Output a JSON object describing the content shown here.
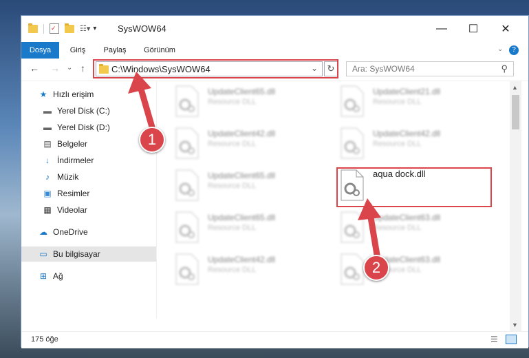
{
  "window": {
    "title": "SysWOW64"
  },
  "window_controls": {
    "minimize": "—",
    "maximize": "☐",
    "close": "✕"
  },
  "ribbon_tabs": [
    "Dosya",
    "Giriş",
    "Paylaş",
    "Görünüm"
  ],
  "nav": {
    "back": "←",
    "forward": "→",
    "recent": "⌄",
    "up": "↑"
  },
  "address": {
    "path": "C:\\Windows\\SysWOW64"
  },
  "search": {
    "placeholder": "Ara: SysWOW64"
  },
  "sidebar": {
    "items": [
      {
        "label": "Hızlı erişim",
        "icon": "star-icon"
      },
      {
        "label": "Yerel Disk (C:)",
        "icon": "drive-icon"
      },
      {
        "label": "Yerel Disk (D:)",
        "icon": "drive-icon"
      },
      {
        "label": "Belgeler",
        "icon": "document-icon"
      },
      {
        "label": "İndirmeler",
        "icon": "download-icon"
      },
      {
        "label": "Müzik",
        "icon": "music-icon"
      },
      {
        "label": "Resimler",
        "icon": "pictures-icon"
      },
      {
        "label": "Videolar",
        "icon": "video-icon"
      },
      {
        "label": "OneDrive",
        "icon": "cloud-icon"
      },
      {
        "label": "Bu bilgisayar",
        "icon": "computer-icon"
      },
      {
        "label": "Ağ",
        "icon": "network-icon"
      }
    ]
  },
  "files": [
    {
      "name": "UpdateClient65.dll",
      "type": "Resource DLL"
    },
    {
      "name": "UpdateClient21.dll",
      "type": "Resource DLL"
    },
    {
      "name": "UpdateClient42.dll",
      "type": "Resource DLL"
    },
    {
      "name": "UpdateClient42.dll",
      "type": "Resource DLL"
    },
    {
      "name": "UpdateClient65.dll",
      "type": "Resource DLL"
    },
    {
      "name": "aqua dock.dll",
      "type": ""
    },
    {
      "name": "UpdateClient65.dll",
      "type": "Resource DLL"
    },
    {
      "name": "UpdateClient63.dll",
      "type": "Resource DLL"
    },
    {
      "name": "UpdateClient42.dll",
      "type": "Resource DLL"
    },
    {
      "name": "UpdateClient63.dll",
      "type": "Resource DLL"
    }
  ],
  "status": {
    "count": "175 öğe"
  },
  "callouts": {
    "one": "1",
    "two": "2"
  },
  "colors": {
    "accent": "#1979ca",
    "highlight": "#d9454b"
  }
}
